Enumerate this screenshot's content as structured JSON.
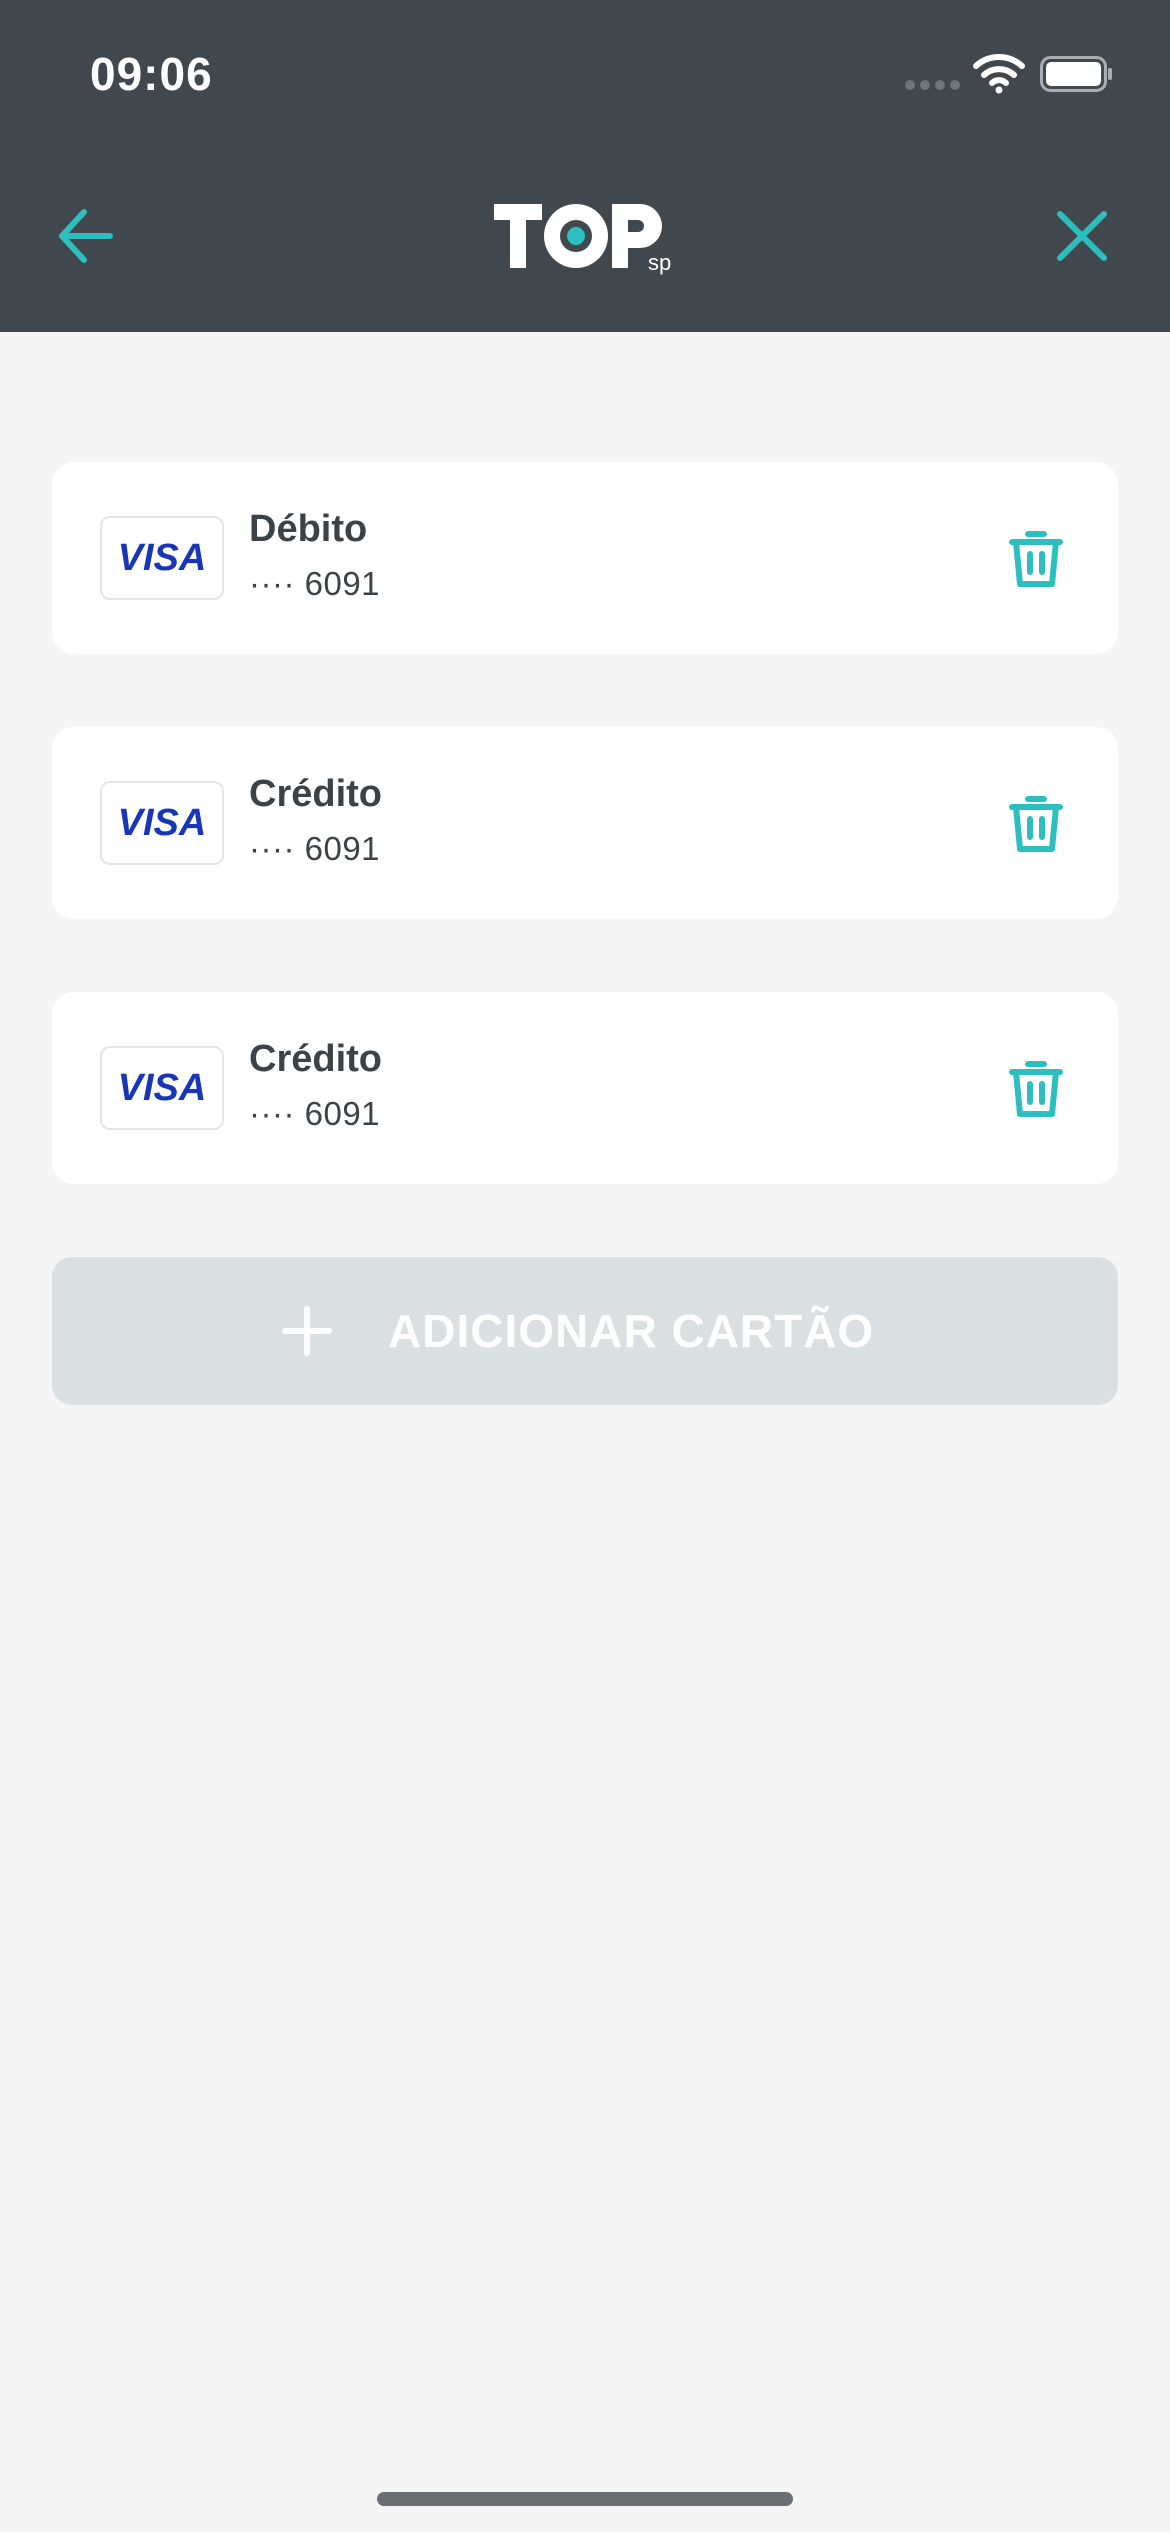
{
  "status_bar": {
    "time": "09:06",
    "icons": [
      "cellular-signal-icon",
      "wifi-icon",
      "battery-icon"
    ]
  },
  "header": {
    "logo_text": "TOP",
    "logo_suffix": "sp",
    "back_icon": "arrow-left-icon",
    "close_icon": "close-icon"
  },
  "cards": [
    {
      "brand": "VISA",
      "type": "Débito",
      "number": "···· 6091",
      "action_icon": "trash-icon"
    },
    {
      "brand": "VISA",
      "type": "Crédito",
      "number": "···· 6091",
      "action_icon": "trash-icon"
    },
    {
      "brand": "VISA",
      "type": "Crédito",
      "number": "···· 6091",
      "action_icon": "trash-icon"
    }
  ],
  "add_button": {
    "icon": "plus-icon",
    "label": "ADICIONAR CARTÃO"
  },
  "colors": {
    "header_bg": "#40474d",
    "accent": "#2dbfbf",
    "visa_blue": "#1a36b8",
    "background": "#f5f5f5",
    "disabled_button": "#dadfe2"
  }
}
